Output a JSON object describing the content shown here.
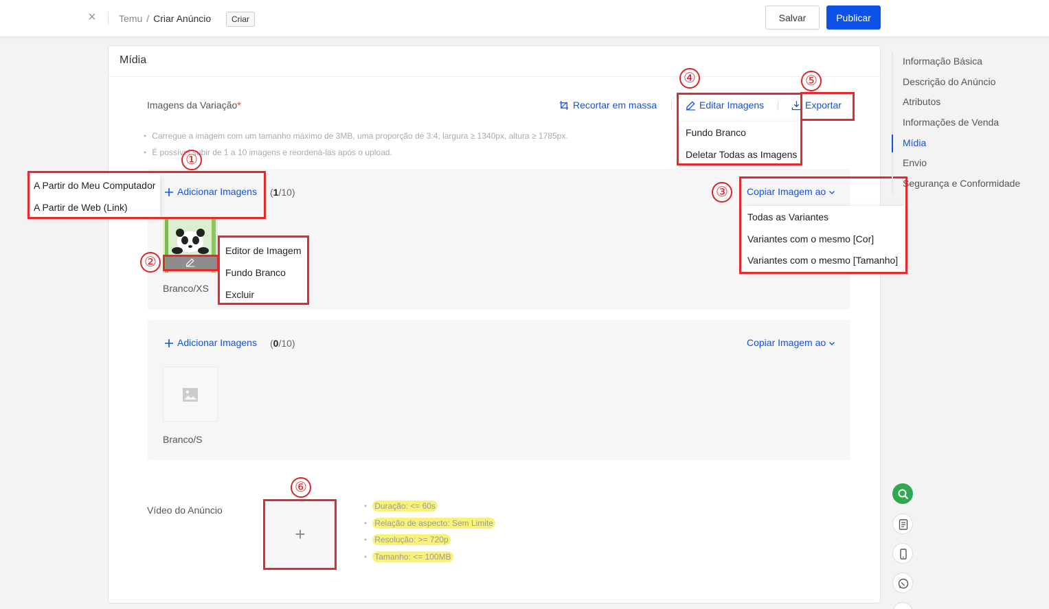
{
  "header": {
    "breadcrumb_root": "Temu",
    "breadcrumb_sep": "/",
    "breadcrumb_current": "Criar Anúncio",
    "tag": "Criar",
    "save_label": "Salvar",
    "publish_label": "Publicar"
  },
  "media": {
    "title": "Mídia",
    "variation_label": "Imagens da Variação",
    "required_mark": "*",
    "bulk_crop": "Recortar em massa",
    "edit_images": "Editar Imagens",
    "export": "Exportar",
    "hints": [
      "Carregue a imagem com um tamanho máximo de 3MB, uma proporção de 3:4, largura ≥ 1340px, altura ≥ 1785px.",
      "É possível subir de 1 a 10 imagens e reordená-las após o upload."
    ],
    "edit_images_menu": [
      "Fundo Branco",
      "Deletar Todas as Imagens"
    ],
    "add_images_menu": [
      "A Partir do Meu Computador",
      "A Partir de Web (Link)"
    ],
    "thumb_menu": [
      "Editor de Imagem",
      "Fundo Branco",
      "Excluir"
    ],
    "copy_menu": [
      "Todas as Variantes",
      "Variantes com o mesmo [Cor]",
      "Variantes com o mesmo [Tamanho]"
    ],
    "variants": [
      {
        "add_label": "Adicionar Imagens",
        "count_open": "(",
        "count_current": "1",
        "count_total": "/10)",
        "copy_label": "Copiar Imagem ao",
        "name": "Branco/XS"
      },
      {
        "add_label": "Adicionar Imagens",
        "count_open": "(",
        "count_current": "0",
        "count_total": "/10)",
        "copy_label": "Copiar Imagem ao",
        "name": "Branco/S"
      }
    ],
    "video_label": "Vídeo do Anúncio",
    "video_hints": [
      "Duração: <= 60s",
      "Relação de aspecto: Sem Limite",
      "Resolução: >= 720p",
      "Tamanho: <= 100MB"
    ]
  },
  "annotations": [
    "①",
    "②",
    "③",
    "④",
    "⑤",
    "⑥"
  ],
  "side_nav": {
    "items": [
      "Informação Básica",
      "Descrição do Anúncio",
      "Atributos",
      "Informações de Venda",
      "Mídia",
      "Envio",
      "Segurança e Conformidade"
    ],
    "active": "Mídia"
  },
  "colors": {
    "accent": "#0d52e8",
    "highlight": "#f8f27a",
    "annotation_red": "#e52a2f"
  },
  "floating_icons": [
    "search-icon",
    "document-icon",
    "phone-icon",
    "whatsapp-icon"
  ]
}
